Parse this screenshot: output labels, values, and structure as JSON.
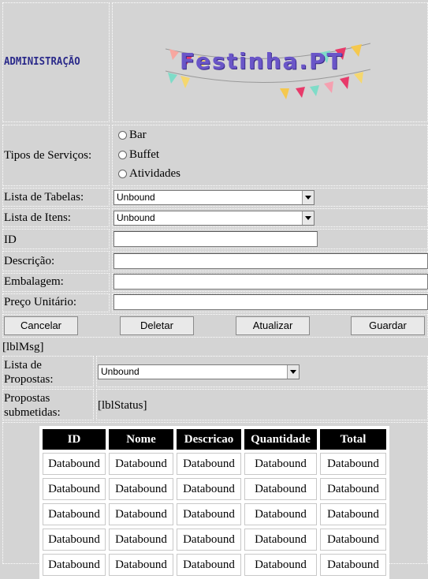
{
  "header": {
    "admin_label": "ADMINISTRAÇÃO",
    "logo_text": "Festinha.PT"
  },
  "services": {
    "label": "Tipos de Serviços:",
    "options": [
      "Bar",
      "Buffet",
      "Atividades"
    ]
  },
  "form": {
    "tables_label": "Lista de Tabelas:",
    "tables_value": "Unbound",
    "items_label": "Lista de Itens:",
    "items_value": "Unbound",
    "id_label": "ID",
    "description_label": "Descrição:",
    "packaging_label": "Embalagem:",
    "unit_price_label": "Preço Unitário:"
  },
  "buttons": {
    "cancel": "Cancelar",
    "delete": "Deletar",
    "update": "Atualizar",
    "save": "Guardar"
  },
  "messages": {
    "lbl_msg": "[lblMsg]",
    "proposals_label_1": "Lista de",
    "proposals_label_2": "Propostas:",
    "proposals_value": "Unbound",
    "submitted_label_1": "Propostas",
    "submitted_label_2": "submetidas:",
    "lbl_status": "[lblStatus]"
  },
  "grid": {
    "columns": [
      "ID",
      "Nome",
      "Descricao",
      "Quantidade",
      "Total"
    ],
    "rows": [
      [
        "Databound",
        "Databound",
        "Databound",
        "Databound",
        "Databound"
      ],
      [
        "Databound",
        "Databound",
        "Databound",
        "Databound",
        "Databound"
      ],
      [
        "Databound",
        "Databound",
        "Databound",
        "Databound",
        "Databound"
      ],
      [
        "Databound",
        "Databound",
        "Databound",
        "Databound",
        "Databound"
      ],
      [
        "Databound",
        "Databound",
        "Databound",
        "Databound",
        "Databound"
      ]
    ]
  },
  "colors": {
    "background": "#d4d4d4",
    "admin_text": "#2b2a8a",
    "logo_text": "#6a56c8",
    "grid_header": "#000000"
  }
}
